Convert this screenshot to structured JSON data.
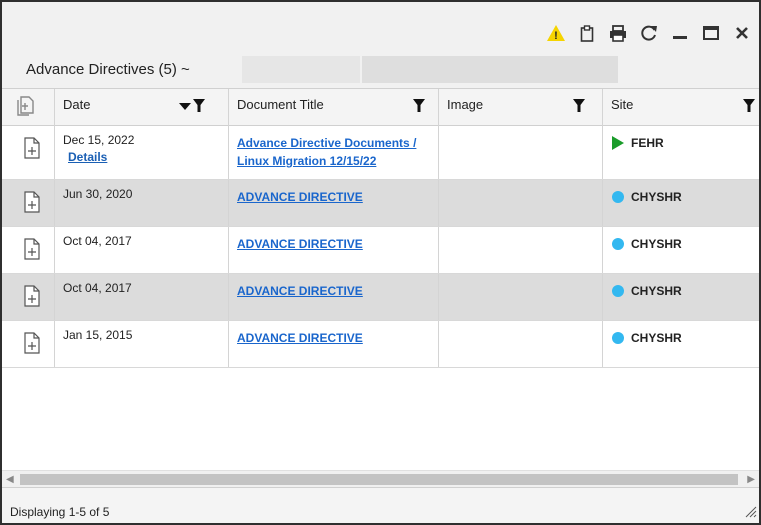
{
  "widget": {
    "title": "Advance Directives (5) ~"
  },
  "toolbar": {
    "icons": [
      "warning-icon",
      "clipboard-icon",
      "print-icon",
      "refresh-icon",
      "minimize-icon",
      "maximize-icon",
      "close-icon"
    ],
    "warning_mark": "!"
  },
  "columns": {
    "date": "Date",
    "title": "Document Title",
    "image": "Image",
    "site": "Site"
  },
  "rows": [
    {
      "date": "Dec 15, 2022",
      "details": "Details",
      "title_line1": "Advance Directive Documents /",
      "title_line2": "Linux Migration 12/15/22",
      "image": "",
      "site": "FEHR",
      "site_marker": "triangle"
    },
    {
      "date": "Jun 30, 2020",
      "title_line1": "ADVANCE DIRECTIVE",
      "image": "",
      "site": "CHYSHR",
      "site_marker": "dot"
    },
    {
      "date": "Oct 04, 2017",
      "title_line1": "ADVANCE DIRECTIVE",
      "image": "",
      "site": "CHYSHR",
      "site_marker": "dot"
    },
    {
      "date": "Oct 04, 2017",
      "title_line1": "ADVANCE DIRECTIVE",
      "image": "",
      "site": "CHYSHR",
      "site_marker": "dot"
    },
    {
      "date": "Jan 15, 2015",
      "title_line1": "ADVANCE DIRECTIVE",
      "image": "",
      "site": "CHYSHR",
      "site_marker": "dot"
    }
  ],
  "status": {
    "text": "Displaying 1-5 of 5"
  },
  "colors": {
    "warning": "#f5d400",
    "link": "#1a66cc",
    "site_dot": "#33b8f0",
    "site_triangle": "#1a9c2a",
    "alt_row": "#dcdcdc"
  }
}
